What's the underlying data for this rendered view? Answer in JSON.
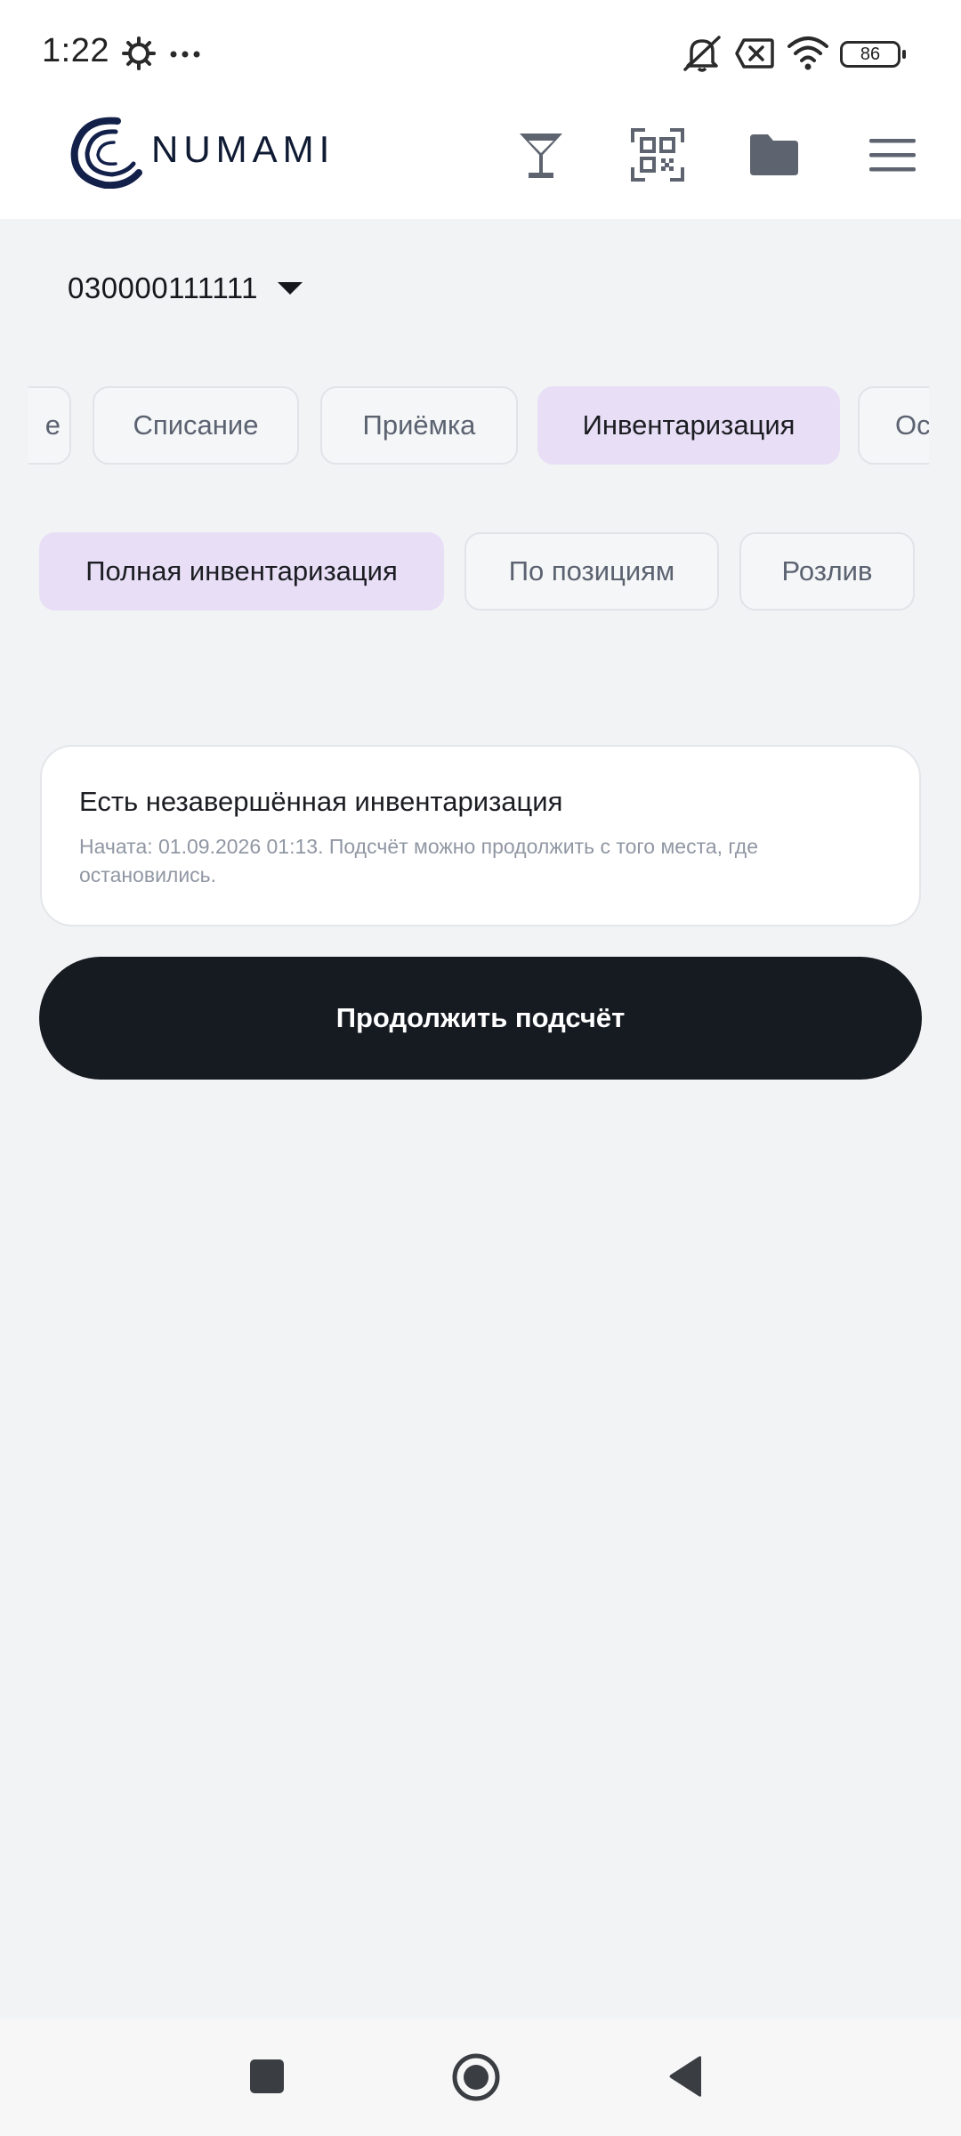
{
  "status_bar": {
    "time": "1:22",
    "battery": "86",
    "icons": [
      "gear-icon",
      "more-dots-icon",
      "bell-muted-icon",
      "no-sim-icon",
      "wifi-icon",
      "battery-icon"
    ]
  },
  "header": {
    "logo_text": "NUMAMI",
    "icons": [
      "cocktail-glass-icon",
      "qr-scan-icon",
      "folder-icon",
      "hamburger-menu-icon"
    ]
  },
  "branch": {
    "value": "030000111111"
  },
  "tabs": [
    {
      "label": "е",
      "active": false
    },
    {
      "label": "Списание",
      "active": false
    },
    {
      "label": "Приёмка",
      "active": false
    },
    {
      "label": "Инвентаризация",
      "active": true
    },
    {
      "label": "Ос",
      "active": false
    }
  ],
  "chips": [
    {
      "label": "Полная инвентаризация",
      "active": true
    },
    {
      "label": "По позициям",
      "active": false
    },
    {
      "label": "Розлив",
      "active": false
    }
  ],
  "notice": {
    "title": "Есть незавершённая инвентаризация",
    "text": "Начата: 01.09.2026 01:13. Подсчёт можно продолжить с того места, где остановились."
  },
  "primary_button": {
    "label": "Продолжить подсчёт"
  },
  "colors": {
    "accent_chip": "#e8dff6",
    "primary_button": "#161a21",
    "background": "#f2f3f5"
  }
}
